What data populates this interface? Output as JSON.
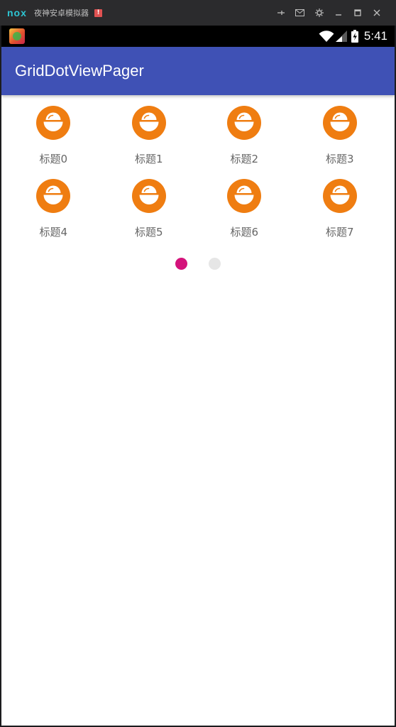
{
  "emulator": {
    "logo": "nox",
    "title": "夜神安卓模拟器",
    "alert": "!"
  },
  "status_bar": {
    "time": "5:41"
  },
  "app_bar": {
    "title": "GridDotViewPager"
  },
  "grid": {
    "items": [
      {
        "label": "标题0",
        "icon": "bowl-icon"
      },
      {
        "label": "标题1",
        "icon": "bowl-icon"
      },
      {
        "label": "标题2",
        "icon": "bowl-icon"
      },
      {
        "label": "标题3",
        "icon": "bowl-icon"
      },
      {
        "label": "标题4",
        "icon": "bowl-icon"
      },
      {
        "label": "标题5",
        "icon": "bowl-icon"
      },
      {
        "label": "标题6",
        "icon": "bowl-icon"
      },
      {
        "label": "标题7",
        "icon": "bowl-icon"
      }
    ]
  },
  "pager": {
    "page_count": 2,
    "current_page": 1
  },
  "colors": {
    "app_bar": "#3f51b5",
    "icon_orange": "#ef7d11",
    "dot_active": "#d4137b",
    "dot_inactive": "#e6e6e6"
  }
}
